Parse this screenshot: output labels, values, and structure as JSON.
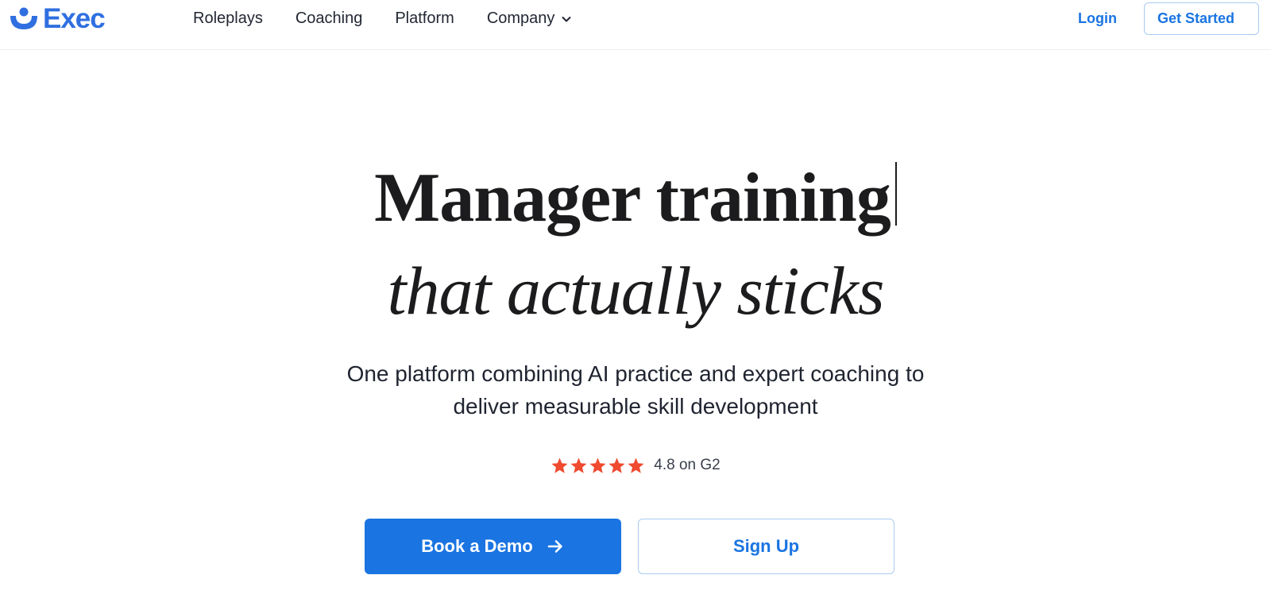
{
  "header": {
    "logo_text": "Exec",
    "nav": [
      {
        "label": "Roleplays"
      },
      {
        "label": "Coaching"
      },
      {
        "label": "Platform"
      },
      {
        "label": "Company",
        "has_dropdown": true
      }
    ],
    "login_label": "Login",
    "get_started_label": "Get Started"
  },
  "hero": {
    "headline_line1": "Manager training",
    "headline_line2": "that actually sticks",
    "subtitle_line1": "One platform combining AI practice and expert coaching to",
    "subtitle_line2": "deliver measurable skill development"
  },
  "rating": {
    "stars": 5,
    "text": "4.8 on G2",
    "star_color": "#f04a2f"
  },
  "cta": {
    "primary_label": "Book a Demo",
    "secondary_label": "Sign Up"
  },
  "colors": {
    "brand_blue": "#1a74e2",
    "logo_blue": "#2f6fe0",
    "text_dark": "#1c1c1e"
  },
  "icons": {
    "logo": "smile-icon",
    "nav_dropdown": "chevron-down-icon",
    "cta_arrow": "arrow-right-icon",
    "rating": "star-icon"
  }
}
